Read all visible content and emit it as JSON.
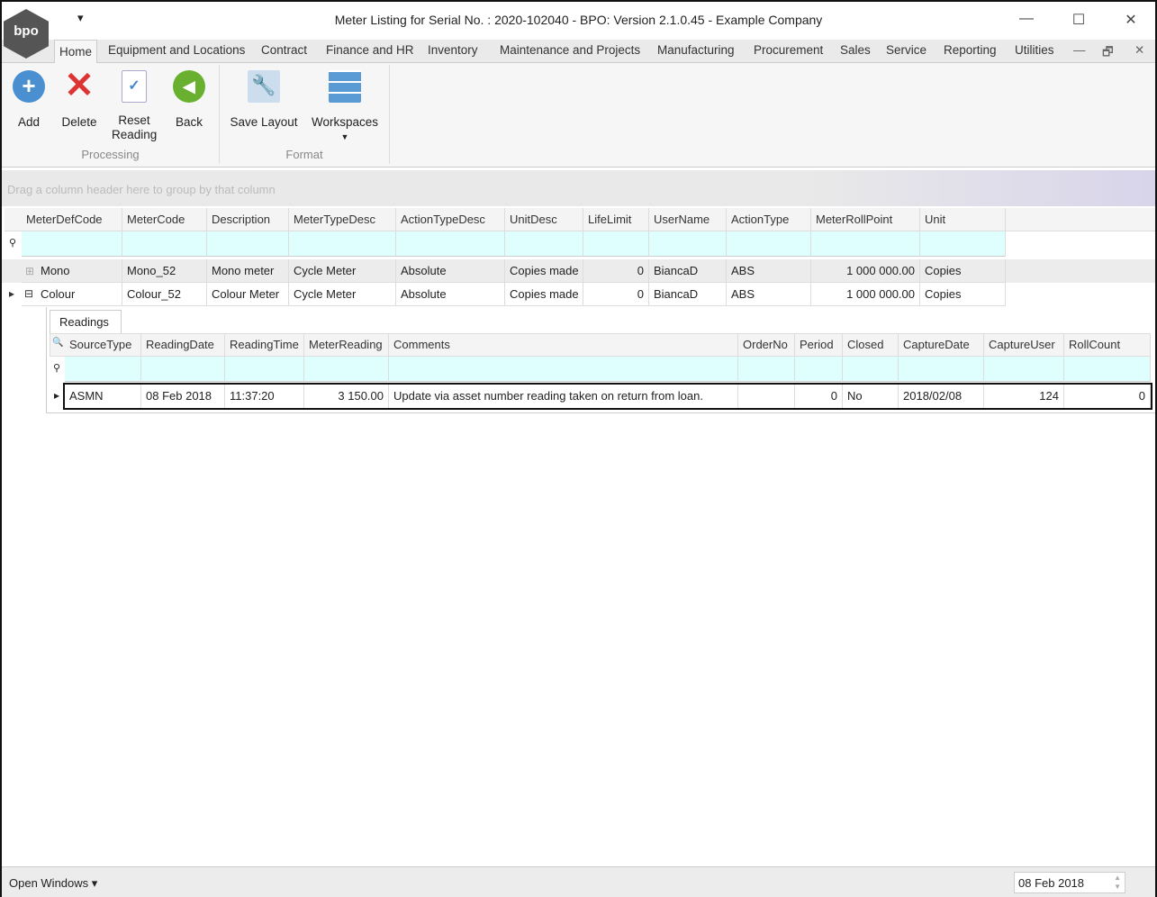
{
  "window": {
    "title": "Meter Listing for Serial No. : 2020-102040 - BPO: Version 2.1.0.45 - Example Company",
    "logo": "bpo",
    "qat": "▾",
    "minimize": "—",
    "maximize": "☐",
    "close": "✕"
  },
  "tabs": [
    "Home",
    "Equipment and Locations",
    "Contract",
    "Finance and HR",
    "Inventory",
    "Maintenance and Projects",
    "Manufacturing",
    "Procurement",
    "Sales",
    "Service",
    "Reporting",
    "Utilities"
  ],
  "ribbon": {
    "add": "Add",
    "delete": "Delete",
    "reset": "Reset Reading",
    "back": "Back",
    "save_layout": "Save Layout",
    "workspaces": "Workspaces",
    "group_processing": "Processing",
    "group_format": "Format"
  },
  "group_hint": "Drag a column header here to group by that column",
  "main_grid": {
    "columns": [
      "MeterDefCode",
      "MeterCode",
      "Description",
      "MeterTypeDesc",
      "ActionTypeDesc",
      "UnitDesc",
      "LifeLimit",
      "UserName",
      "ActionType",
      "MeterRollPoint",
      "Unit"
    ],
    "rows": [
      [
        "Mono",
        "Mono_52",
        "Mono meter",
        "Cycle Meter",
        "Absolute",
        "Copies made",
        "0",
        "BiancaD",
        "ABS",
        "1 000 000.00",
        "Copies"
      ],
      [
        "Colour",
        "Colour_52",
        "Colour Meter",
        "Cycle Meter",
        "Absolute",
        "Copies made",
        "0",
        "BiancaD",
        "ABS",
        "1 000 000.00",
        "Copies"
      ]
    ]
  },
  "detail": {
    "tab": "Readings",
    "columns": [
      "SourceType",
      "ReadingDate",
      "ReadingTime",
      "MeterReading",
      "Comments",
      "OrderNo",
      "Period",
      "Closed",
      "CaptureDate",
      "CaptureUser",
      "RollCount"
    ],
    "rows": [
      [
        "ASMN",
        "08 Feb 2018",
        "11:37:20",
        "3 150.00",
        "Update via asset number reading taken on return from loan.",
        "",
        "0",
        "No",
        "2018/02/08",
        "124",
        "0"
      ]
    ]
  },
  "status": {
    "open_windows": "Open Windows ▾",
    "date": "08 Feb 2018"
  }
}
